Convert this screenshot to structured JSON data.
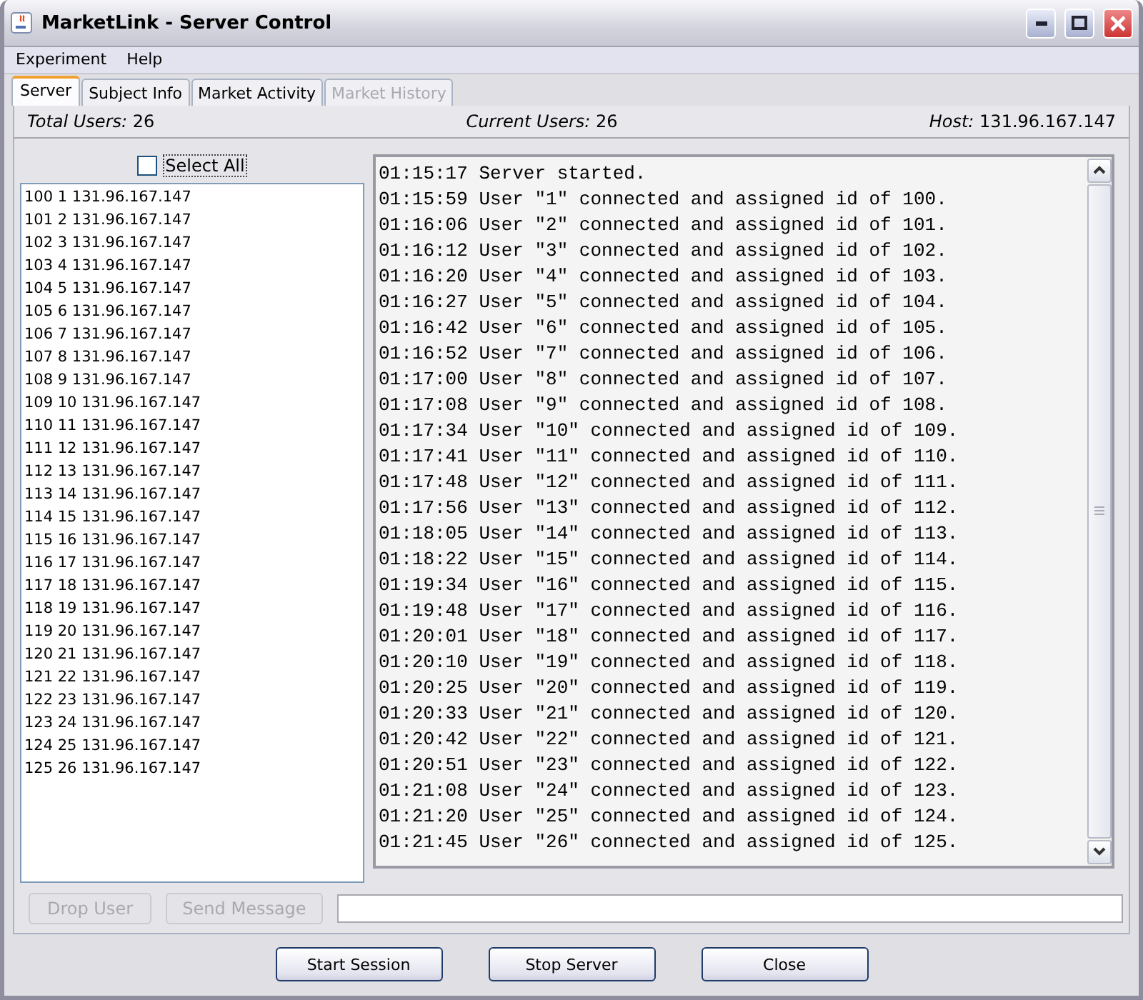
{
  "window": {
    "title": "MarketLink - Server Control"
  },
  "menu": [
    {
      "label": "Experiment"
    },
    {
      "label": "Help"
    }
  ],
  "tabs": [
    {
      "label": "Server",
      "selected": true,
      "disabled": false
    },
    {
      "label": "Subject Info",
      "selected": false,
      "disabled": false
    },
    {
      "label": "Market Activity",
      "selected": false,
      "disabled": false
    },
    {
      "label": "Market History",
      "selected": false,
      "disabled": true
    }
  ],
  "info": {
    "total_label": "Total Users:",
    "total": "26",
    "current_label": "Current Users:",
    "current": "26",
    "host_label": "Host:",
    "host": "131.96.167.147"
  },
  "select_all": {
    "label": "Select All",
    "checked": false
  },
  "users": [
    "100 1 131.96.167.147",
    "101 2 131.96.167.147",
    "102 3 131.96.167.147",
    "103 4 131.96.167.147",
    "104 5 131.96.167.147",
    "105 6 131.96.167.147",
    "106 7 131.96.167.147",
    "107 8 131.96.167.147",
    "108 9 131.96.167.147",
    "109 10 131.96.167.147",
    "110 11 131.96.167.147",
    "111 12 131.96.167.147",
    "112 13 131.96.167.147",
    "113 14 131.96.167.147",
    "114 15 131.96.167.147",
    "115 16 131.96.167.147",
    "116 17 131.96.167.147",
    "117 18 131.96.167.147",
    "118 19 131.96.167.147",
    "119 20 131.96.167.147",
    "120 21 131.96.167.147",
    "121 22 131.96.167.147",
    "122 23 131.96.167.147",
    "123 24 131.96.167.147",
    "124 25 131.96.167.147",
    "125 26 131.96.167.147"
  ],
  "log": [
    "01:15:17 Server started.",
    "01:15:59 User \"1\" connected and assigned id of 100.",
    "01:16:06 User \"2\" connected and assigned id of 101.",
    "01:16:12 User \"3\" connected and assigned id of 102.",
    "01:16:20 User \"4\" connected and assigned id of 103.",
    "01:16:27 User \"5\" connected and assigned id of 104.",
    "01:16:42 User \"6\" connected and assigned id of 105.",
    "01:16:52 User \"7\" connected and assigned id of 106.",
    "01:17:00 User \"8\" connected and assigned id of 107.",
    "01:17:08 User \"9\" connected and assigned id of 108.",
    "01:17:34 User \"10\" connected and assigned id of 109.",
    "01:17:41 User \"11\" connected and assigned id of 110.",
    "01:17:48 User \"12\" connected and assigned id of 111.",
    "01:17:56 User \"13\" connected and assigned id of 112.",
    "01:18:05 User \"14\" connected and assigned id of 113.",
    "01:18:22 User \"15\" connected and assigned id of 114.",
    "01:19:34 User \"16\" connected and assigned id of 115.",
    "01:19:48 User \"17\" connected and assigned id of 116.",
    "01:20:01 User \"18\" connected and assigned id of 117.",
    "01:20:10 User \"19\" connected and assigned id of 118.",
    "01:20:25 User \"20\" connected and assigned id of 119.",
    "01:20:33 User \"21\" connected and assigned id of 120.",
    "01:20:42 User \"22\" connected and assigned id of 121.",
    "01:20:51 User \"23\" connected and assigned id of 122.",
    "01:21:08 User \"24\" connected and assigned id of 123.",
    "01:21:20 User \"25\" connected and assigned id of 124.",
    "01:21:45 User \"26\" connected and assigned id of 125."
  ],
  "actions": [
    {
      "label": "Drop User",
      "disabled": true
    },
    {
      "label": "Send Message",
      "disabled": true
    }
  ],
  "buttons": [
    {
      "label": "Start Session"
    },
    {
      "label": "Stop Server"
    },
    {
      "label": "Close"
    }
  ]
}
